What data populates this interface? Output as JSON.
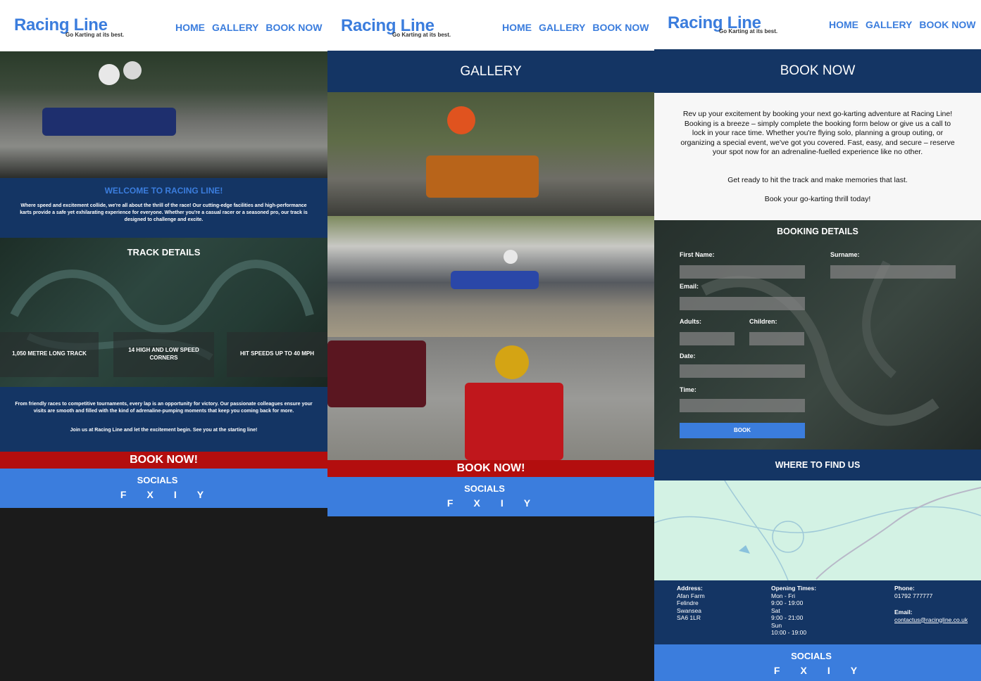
{
  "brand": {
    "name": "Racing Line",
    "tagline": "Go Karting at its best."
  },
  "nav": [
    "HOME",
    "GALLERY",
    "BOOK NOW"
  ],
  "home": {
    "welcome_title": "WELCOME TO RACING LINE!",
    "welcome_text": "Where speed and excitement collide, we're all about the thrill of the race! Our cutting-edge facilities and high-performance karts provide a safe yet exhilarating experience for everyone. Whether you're a casual racer or a seasoned pro, our track is designed to challenge and excite.",
    "track_title": "TRACK DETAILS",
    "stats": [
      "1,050 METRE LONG TRACK",
      "14 HIGH AND LOW SPEED CORNERS",
      "HIT SPEEDS UP TO 40 MPH"
    ],
    "outro_1": "From friendly races to competitive tournaments, every lap is an opportunity for victory. Our passionate colleagues ensure your visits are smooth and filled with the kind of adrenaline-pumping moments that keep you coming back for more.",
    "outro_2": "Join us at Racing Line and let the excitement begin. See you at the starting line!"
  },
  "gallery": {
    "title": "GALLERY"
  },
  "book_now_banner": "BOOK NOW!",
  "socials": {
    "title": "SOCIALS",
    "icons": [
      "F",
      "X",
      "I",
      "Y"
    ]
  },
  "booking": {
    "title": "BOOK NOW",
    "intro": "Rev up your excitement by booking your next go-karting adventure at Racing Line! Booking is a breeze – simply complete the booking form below or give us a call to lock in your race time. Whether you're flying solo, planning a group outing, or organizing a special event, we've got you covered. Fast, easy, and secure – reserve your spot now for an adrenaline-fuelled experience like no other.",
    "line2": "Get ready to hit the track and make memories that last.",
    "line3": "Book your go-karting thrill today!",
    "form_title": "BOOKING DETAILS",
    "labels": {
      "first_name": "First Name:",
      "surname": "Surname:",
      "email": "Email:",
      "adults": "Adults:",
      "children": "Children:",
      "date": "Date:",
      "time": "Time:"
    },
    "submit": "BOOK"
  },
  "find_us": {
    "title": "WHERE TO FIND US",
    "address_label": "Address:",
    "address": [
      "Afan Farm",
      "Felindre",
      "Swansea",
      "SA6 1LR"
    ],
    "times_label": "Opening Times:",
    "times": [
      "Mon - Fri",
      "9:00 - 19:00",
      "Sat",
      "9:00 - 21:00",
      "Sun",
      "10:00 - 19:00"
    ],
    "phone_label": "Phone:",
    "phone": "01792 777777",
    "email_label": "Email:",
    "email": "contactus@racingline.co.uk"
  },
  "colors": {
    "accent": "#3b7ddd",
    "navy": "#143564",
    "red": "#b30e0e"
  }
}
